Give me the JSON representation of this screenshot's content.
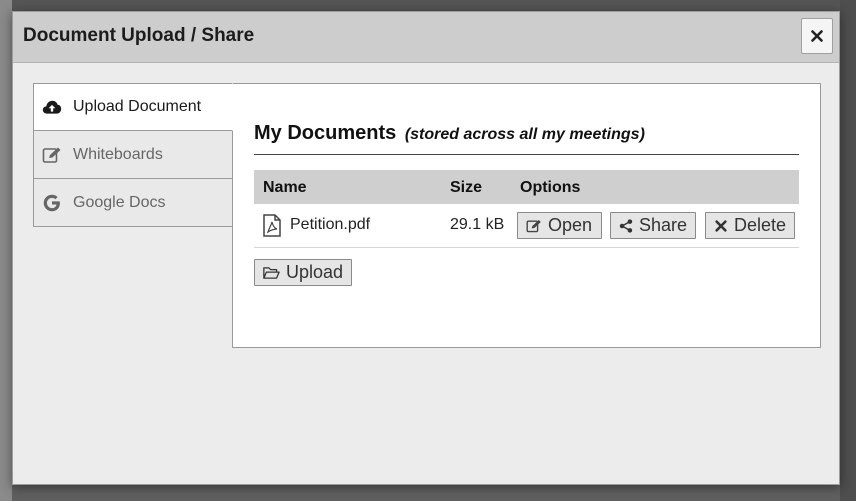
{
  "modal": {
    "title": "Document Upload / Share",
    "close_icon": "close-icon"
  },
  "tabs": [
    {
      "label": "Upload Document",
      "icon": "cloud-upload-icon",
      "active": true
    },
    {
      "label": "Whiteboards",
      "icon": "edit-icon",
      "active": false
    },
    {
      "label": "Google Docs",
      "icon": "google-icon",
      "active": false
    }
  ],
  "section": {
    "title": "My Documents",
    "subtitle": "(stored across all my meetings)"
  },
  "table": {
    "headers": {
      "name": "Name",
      "size": "Size",
      "options": "Options"
    },
    "rows": [
      {
        "name": "Petition.pdf",
        "size": "29.1 kB",
        "icon": "pdf-file-icon"
      }
    ]
  },
  "actions": {
    "open": "Open",
    "share": "Share",
    "delete": "Delete",
    "upload": "Upload"
  }
}
